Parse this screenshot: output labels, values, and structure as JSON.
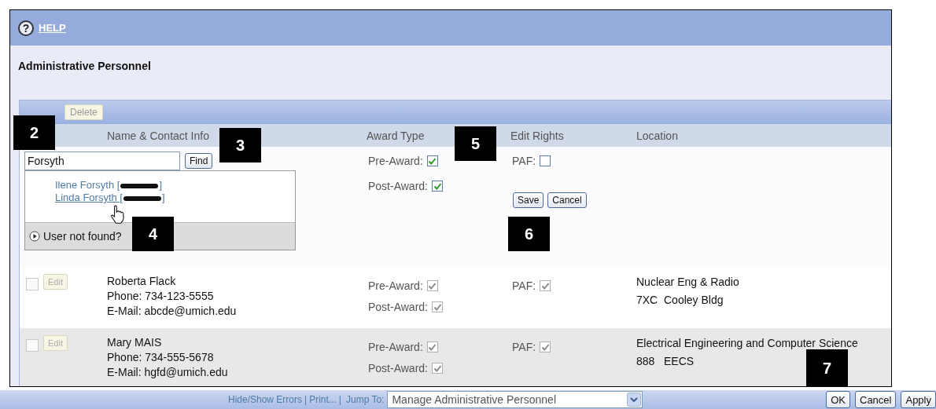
{
  "header": {
    "help_icon": "?",
    "help_link": "HELP"
  },
  "title": "Administrative Personnel",
  "toolbar": {
    "buttons": [
      {
        "label": "Delete",
        "disabled": true
      }
    ]
  },
  "columns": [
    "Name & Contact Info",
    "Award Type",
    "Edit Rights",
    "Location"
  ],
  "editor": {
    "search_value": "Forsyth",
    "find_button": "Find",
    "results": [
      {
        "name": "Ilene Forsyth",
        "bracket_open": "[",
        "bracket_close": "]",
        "hovered": false
      },
      {
        "name": "Linda Forsyth",
        "bracket_open": "[",
        "bracket_close": "]",
        "hovered": true
      }
    ],
    "not_found": "User not found?",
    "awards": [
      {
        "label": "Pre-Award:",
        "checked": true,
        "disabled": false
      },
      {
        "label": "Post-Award:",
        "checked": true,
        "disabled": false
      }
    ],
    "rights": [
      {
        "label": "PAF:",
        "checked": false,
        "disabled": false
      }
    ],
    "buttons": [
      "Save",
      "Cancel"
    ]
  },
  "rows": [
    {
      "selected": false,
      "edit": "Edit",
      "name": "Roberta Flack",
      "phone": "Phone: 734-123-5555",
      "email": "E-Mail: abcde@umich.edu",
      "awards": [
        {
          "label": "Pre-Award:",
          "checked": true,
          "disabled": true
        },
        {
          "label": "Post-Award:",
          "checked": true,
          "disabled": true
        }
      ],
      "rights": [
        {
          "label": "PAF:",
          "checked": true,
          "disabled": true
        }
      ],
      "location": [
        "Nuclear Eng & Radio",
        "7XC  Cooley Bldg"
      ]
    },
    {
      "selected": false,
      "edit": "Edit",
      "name": "Mary MAIS",
      "phone": "Phone: 734-555-5678",
      "email": "E-Mail: hgfd@umich.edu",
      "awards": [
        {
          "label": "Pre-Award:",
          "checked": true,
          "disabled": true
        },
        {
          "label": "Post-Award:",
          "checked": true,
          "disabled": true
        }
      ],
      "rights": [
        {
          "label": "PAF:",
          "checked": true,
          "disabled": true
        }
      ],
      "location": [
        "Electrical Engineering and Computer Science",
        "888   EECS"
      ]
    }
  ],
  "footer": {
    "links": [
      "Hide/Show Errors",
      "Print..."
    ],
    "separator": "|",
    "jump_label": "Jump To:",
    "jump_value": "Manage Administrative Personnel",
    "buttons": [
      "OK",
      "Cancel",
      "Apply"
    ]
  },
  "callouts": [
    "2",
    "3",
    "4",
    "5",
    "6",
    "7"
  ]
}
